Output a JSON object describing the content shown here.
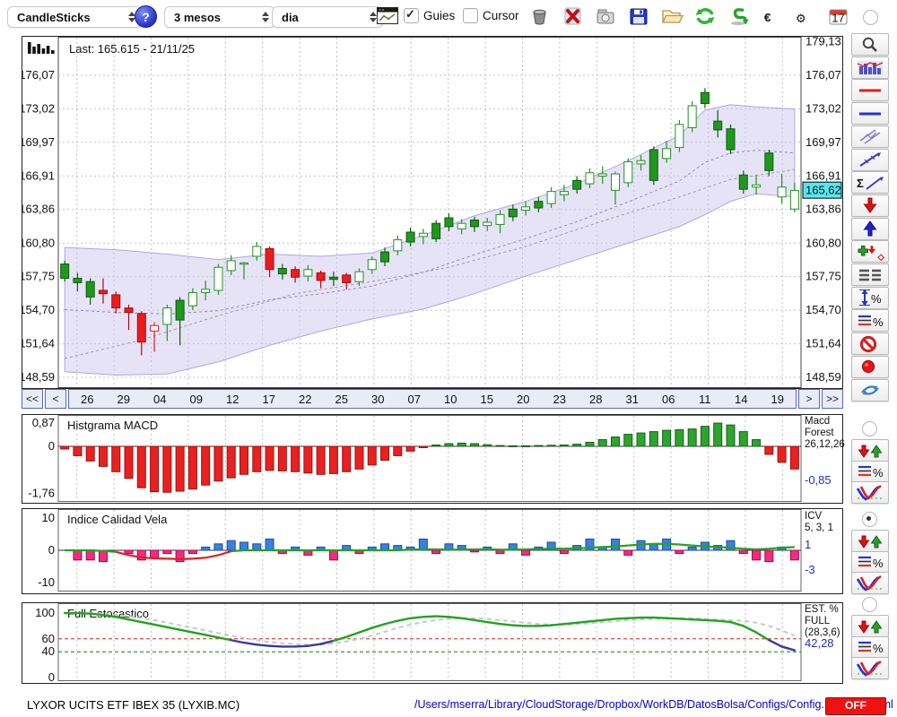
{
  "toolbar": {
    "chart_type_label": "CandleSticks",
    "help_label": "?",
    "period_label": "3 mesos",
    "interval_label": "dia",
    "guies_label": "Guies",
    "cursor_label": "Cursor",
    "calendar_day": "17",
    "icons": [
      "trash-icon",
      "delete-icon",
      "snapshot-icon",
      "save-icon",
      "open-folder-icon",
      "refresh-icon",
      "sync-icon",
      "euro-icon",
      "settings-gear-icon",
      "calendar-icon"
    ]
  },
  "nav": {
    "first_label": "<<",
    "prev_label": "<",
    "next_label": ">",
    "last_label": ">>"
  },
  "panels": {
    "macd": {
      "right_text": "Macd\nForest\n26,12,26",
      "value": "-0,85"
    },
    "icv": {
      "right_text": "ICV\n5, 3, 1",
      "value1": "1",
      "value2": "-3"
    },
    "stoch": {
      "right_text": "EST. %\nFULL\n(28,3,6)",
      "value": "42,28"
    }
  },
  "statusbar": {
    "symbol": "LYXOR UCITS ETF IBEX 35 (LYXIB.MC)",
    "config_path": "/Users/mserra/Library/CloudStorage/Dropbox/WorkDB/DatosBolsa/Configs/Config.DEFAULT.xml",
    "off_label": "OFF"
  },
  "sidebar": {
    "tools": [
      "zoom-icon",
      "indicator-chart-icon",
      "red-line-icon",
      "blue-line-icon",
      "channel-icon",
      "trendline-icon",
      "sigma-trendline-icon",
      "arrow-down-icon",
      "arrow-up-icon",
      "add-signal-icon",
      "levels-icon",
      "measure-percent-icon",
      "lines-percent-icon",
      "forbidden-icon",
      "record-icon",
      "swap-arrows-icon"
    ],
    "group_icons": [
      "signal-arrows-icon",
      "lines-percent-icon",
      "curve-icon"
    ],
    "groups": [
      {
        "name": "macd-tools",
        "selected": false
      },
      {
        "name": "icv-tools",
        "selected": true
      },
      {
        "name": "stoch-tools",
        "selected": false
      }
    ]
  },
  "colors": {
    "candle_green": "#21971f",
    "candle_red": "#ed1c1c",
    "band_fill": "#cfc8ee",
    "band_edge": "#a79ede",
    "macd_pos": "#2da42d",
    "macd_neg": "#ea2020",
    "icv_pos": "#3b7fe0",
    "icv_neg": "#f02d7d",
    "line_green": "#1fa51f",
    "line_red": "#e02020",
    "line_purple": "#3a3aa0",
    "tag_bg": "#56e7f0",
    "value_blue": "#2230cc",
    "off_red": "#ee1212"
  },
  "chart_data": [
    {
      "type": "candlestick",
      "name": "price-chart",
      "last_label": "Last: 165.615 - 21/11/25",
      "last": {
        "price": 165.615,
        "date": "21/11/25"
      },
      "tag": {
        "label": "165,62",
        "v": 165.62
      },
      "right_top_tick": {
        "label": "179,13",
        "v": 179.13
      },
      "ylim": [
        147.8,
        179.7
      ],
      "y_ticks": [
        {
          "label": "176,07",
          "v": 176.07
        },
        {
          "label": "173,02",
          "v": 173.02
        },
        {
          "label": "169,97",
          "v": 169.97
        },
        {
          "label": "166,91",
          "v": 166.91
        },
        {
          "label": "163,86",
          "v": 163.86
        },
        {
          "label": "160,80",
          "v": 160.8
        },
        {
          "label": "157,75",
          "v": 157.75
        },
        {
          "label": "154,70",
          "v": 154.7
        },
        {
          "label": "151,64",
          "v": 151.64
        },
        {
          "label": "148,59",
          "v": 148.59
        }
      ],
      "x_labels": [
        "26",
        "29",
        "04",
        "09",
        "12",
        "17",
        "22",
        "25",
        "30",
        "07",
        "10",
        "15",
        "20",
        "23",
        "28",
        "31",
        "06",
        "11",
        "14",
        "19"
      ],
      "candles": [
        [
          157.6,
          159.2,
          157.3,
          158.9,
          "gf"
        ],
        [
          157.2,
          158.1,
          156.4,
          157.6,
          "gf"
        ],
        [
          157.3,
          157.6,
          155.2,
          155.9,
          "gf"
        ],
        [
          156.5,
          157.6,
          155.3,
          156.2,
          "rf"
        ],
        [
          156.1,
          156.4,
          154.4,
          154.9,
          "rf"
        ],
        [
          154.9,
          155.2,
          152.9,
          154.5,
          "rf"
        ],
        [
          154.4,
          154.6,
          150.6,
          151.8,
          "rf"
        ],
        [
          152.8,
          153.6,
          150.9,
          153.3,
          "rh"
        ],
        [
          153.4,
          155.2,
          151.9,
          154.9,
          "gh"
        ],
        [
          153.8,
          155.9,
          151.5,
          155.6,
          "gf"
        ],
        [
          155.1,
          156.7,
          154.7,
          156.3,
          "gh"
        ],
        [
          156.3,
          157.4,
          155.6,
          156.6,
          "gh"
        ],
        [
          156.5,
          158.9,
          156.1,
          158.6,
          "gh"
        ],
        [
          158.3,
          159.7,
          157.9,
          159.2,
          "gh"
        ],
        [
          158.9,
          159.1,
          157.5,
          159.0,
          "gh"
        ],
        [
          159.6,
          160.9,
          159.2,
          160.5,
          "gh"
        ],
        [
          160.3,
          160.5,
          157.7,
          158.4,
          "rf"
        ],
        [
          158.0,
          158.9,
          157.5,
          158.5,
          "gf"
        ],
        [
          158.4,
          158.7,
          157.2,
          157.7,
          "rf"
        ],
        [
          157.8,
          158.8,
          157.3,
          158.4,
          "gh"
        ],
        [
          158.1,
          158.3,
          156.7,
          157.4,
          "rf"
        ],
        [
          157.5,
          158.2,
          156.9,
          157.7,
          "gf"
        ],
        [
          157.9,
          158.1,
          156.6,
          157.2,
          "rf"
        ],
        [
          157.3,
          158.5,
          156.9,
          158.2,
          "gh"
        ],
        [
          158.4,
          159.6,
          158.0,
          159.3,
          "gh"
        ],
        [
          159.1,
          160.4,
          158.7,
          160.0,
          "gf"
        ],
        [
          160.1,
          161.5,
          159.7,
          161.1,
          "gh"
        ],
        [
          160.9,
          162.2,
          160.5,
          161.8,
          "gf"
        ],
        [
          161.4,
          162.1,
          160.7,
          161.7,
          "gh"
        ],
        [
          161.2,
          162.9,
          160.9,
          162.6,
          "gf"
        ],
        [
          162.3,
          163.5,
          161.9,
          163.1,
          "gf"
        ],
        [
          162.1,
          163.0,
          161.6,
          162.6,
          "gh"
        ],
        [
          162.3,
          163.2,
          161.8,
          162.9,
          "gf"
        ],
        [
          162.4,
          163.1,
          161.9,
          162.7,
          "gh"
        ],
        [
          162.5,
          163.8,
          161.7,
          163.4,
          "gh"
        ],
        [
          163.2,
          164.3,
          162.8,
          163.9,
          "gf"
        ],
        [
          163.8,
          164.6,
          163.3,
          164.1,
          "gh"
        ],
        [
          164.0,
          165.0,
          163.6,
          164.6,
          "gf"
        ],
        [
          164.4,
          165.9,
          164.0,
          165.5,
          "gh"
        ],
        [
          165.2,
          166.1,
          164.6,
          165.5,
          "gh"
        ],
        [
          165.7,
          166.9,
          165.3,
          166.5,
          "gf"
        ],
        [
          166.2,
          167.6,
          165.8,
          167.2,
          "gh"
        ],
        [
          166.9,
          167.8,
          166.2,
          167.1,
          "gh"
        ],
        [
          165.6,
          167.3,
          164.3,
          167.1,
          "gh"
        ],
        [
          166.3,
          168.5,
          165.9,
          168.2,
          "gh"
        ],
        [
          168.0,
          168.8,
          167.4,
          168.3,
          "gh"
        ],
        [
          166.5,
          169.6,
          166.1,
          169.3,
          "gf"
        ],
        [
          168.5,
          170.1,
          168.1,
          169.4,
          "gh"
        ],
        [
          169.5,
          172.0,
          169.1,
          171.6,
          "gh"
        ],
        [
          171.3,
          173.7,
          170.9,
          173.3,
          "gh"
        ],
        [
          173.5,
          174.9,
          173.1,
          174.5,
          "gf"
        ],
        [
          171.9,
          172.9,
          170.4,
          171.1,
          "gf"
        ],
        [
          171.2,
          171.6,
          168.9,
          169.3,
          "gf"
        ],
        [
          167.0,
          167.4,
          165.3,
          165.7,
          "gf"
        ],
        [
          166.1,
          167.0,
          165.2,
          165.9,
          "gh"
        ],
        [
          167.4,
          169.3,
          166.9,
          169.0,
          "gf"
        ],
        [
          165.0,
          167.1,
          164.4,
          165.9,
          "gh"
        ],
        [
          163.9,
          166.3,
          163.6,
          165.6,
          "gh"
        ]
      ],
      "band": {
        "samples": [
          [
            0,
            160.4,
            149.1
          ],
          [
            4,
            160.2,
            148.8
          ],
          [
            8,
            159.8,
            148.9
          ],
          [
            12,
            159.3,
            150.0
          ],
          [
            16,
            159.8,
            151.5
          ],
          [
            20,
            159.6,
            152.8
          ],
          [
            24,
            159.9,
            153.9
          ],
          [
            28,
            161.5,
            154.8
          ],
          [
            32,
            163.3,
            156.2
          ],
          [
            36,
            164.6,
            157.8
          ],
          [
            40,
            166.2,
            159.3
          ],
          [
            44,
            168.3,
            160.8
          ],
          [
            48,
            170.6,
            162.3
          ],
          [
            50,
            172.9,
            163.4
          ],
          [
            52,
            173.4,
            164.6
          ],
          [
            54,
            173.2,
            165.3
          ],
          [
            57,
            173.0,
            165.0
          ]
        ],
        "sma2": [
          [
            0,
            150.3
          ],
          [
            6,
            152.0
          ],
          [
            12,
            154.2
          ],
          [
            18,
            156.2
          ],
          [
            24,
            157.3
          ],
          [
            30,
            158.6
          ],
          [
            36,
            160.5
          ],
          [
            42,
            162.8
          ],
          [
            48,
            165.0
          ],
          [
            52,
            166.6
          ],
          [
            57,
            167.5
          ]
        ]
      }
    },
    {
      "type": "bar",
      "name": "macd-histogram",
      "title": "Histgrama MACD",
      "params": "26,12,26",
      "last_value": -0.85,
      "y_ticks": [
        {
          "label": "0,87",
          "v": 0.87
        },
        {
          "label": "0",
          "v": 0
        },
        {
          "label": "-1,76",
          "v": -1.76
        }
      ],
      "values": [
        -0.1,
        -0.35,
        -0.55,
        -0.75,
        -0.95,
        -1.2,
        -1.55,
        -1.7,
        -1.72,
        -1.68,
        -1.6,
        -1.45,
        -1.3,
        -1.18,
        -1.05,
        -0.95,
        -0.9,
        -0.92,
        -0.95,
        -1.0,
        -1.05,
        -1.02,
        -0.95,
        -0.85,
        -0.7,
        -0.52,
        -0.35,
        -0.18,
        -0.05,
        0.05,
        0.1,
        0.12,
        0.1,
        0.06,
        0.03,
        0.02,
        0.02,
        0.03,
        0.04,
        0.05,
        0.08,
        0.15,
        0.25,
        0.35,
        0.45,
        0.5,
        0.55,
        0.6,
        0.62,
        0.65,
        0.75,
        0.87,
        0.8,
        0.55,
        0.25,
        -0.3,
        -0.6,
        -0.85
      ]
    },
    {
      "type": "bar+line",
      "name": "icv",
      "title": "Indice Calidad Vela",
      "params": "5, 3, 1",
      "last_line_value": 1,
      "last_bar_value": -3,
      "y_ticks": [
        {
          "label": "10",
          "v": 10
        },
        {
          "label": "0",
          "v": 0
        },
        {
          "label": "-10",
          "v": -10
        }
      ],
      "bars": [
        0,
        -3,
        -3,
        -3.5,
        0,
        -1,
        -3,
        -2.5,
        -1,
        -3.5,
        -1,
        1,
        2,
        3,
        2.5,
        2,
        3.5,
        -1,
        1,
        -1.5,
        1,
        -3,
        1.5,
        -1,
        1,
        2,
        1.5,
        1,
        3.5,
        -1,
        2,
        1.5,
        -0.5,
        1,
        -1,
        2,
        -1.5,
        1,
        2.5,
        -1,
        1.5,
        3.5,
        1,
        3.5,
        -1.5,
        3,
        2,
        3.5,
        -1,
        1,
        2.5,
        1.5,
        3,
        -1,
        -3,
        -3.5,
        1,
        -3
      ],
      "line": [
        0,
        0,
        0,
        -0.2,
        -0.5,
        -1.5,
        -2.2,
        -2.5,
        -2.6,
        -2.7,
        -2.6,
        -2.3,
        -1.5,
        -0.3,
        0,
        0,
        0,
        0,
        0,
        0,
        0,
        0,
        0,
        0,
        0,
        0,
        0,
        0.2,
        0.3,
        0.3,
        0.2,
        0.2,
        0.3,
        0.3,
        0.2,
        0.2,
        0.3,
        0.4,
        0.5,
        0.5,
        0.6,
        0.8,
        1.0,
        1.2,
        1.5,
        1.8,
        2.0,
        2.0,
        1.8,
        1.5,
        1.2,
        1.0,
        0.8,
        0.5,
        0.3,
        0.5,
        0.8,
        1.0
      ]
    },
    {
      "type": "line",
      "name": "full-stochastic",
      "title": "Full Estocastico",
      "params": "(28,3,6)",
      "last_value": 42.28,
      "thresholds": {
        "upper": 60,
        "lower": 40
      },
      "y_ticks": [
        {
          "label": "100",
          "v": 100
        },
        {
          "label": "60",
          "v": 60
        },
        {
          "label": "40",
          "v": 40
        },
        {
          "label": "0",
          "v": 0
        }
      ],
      "k": [
        100,
        100,
        99,
        97,
        94,
        90,
        86,
        82,
        78,
        74,
        70,
        66,
        62,
        58,
        54,
        51,
        49,
        48,
        48,
        49,
        52,
        57,
        63,
        70,
        77,
        83,
        88,
        92,
        94,
        95,
        94,
        92,
        89,
        86,
        83,
        81,
        80,
        80,
        81,
        83,
        85,
        87,
        89,
        91,
        92,
        93,
        93,
        92,
        91,
        90,
        89,
        88,
        86,
        80,
        70,
        58,
        48,
        42.28
      ],
      "d": [
        100,
        100,
        100,
        99,
        97,
        95,
        92,
        89,
        85,
        81,
        77,
        73,
        69,
        65,
        61,
        58,
        55,
        53,
        52,
        51,
        51,
        53,
        56,
        60,
        65,
        71,
        77,
        82,
        86,
        89,
        91,
        92,
        92,
        91,
        89,
        87,
        85,
        83,
        82,
        82,
        83,
        84,
        86,
        87,
        89,
        90,
        91,
        92,
        92,
        92,
        91,
        90,
        89,
        88,
        85,
        80,
        73,
        65
      ]
    }
  ]
}
